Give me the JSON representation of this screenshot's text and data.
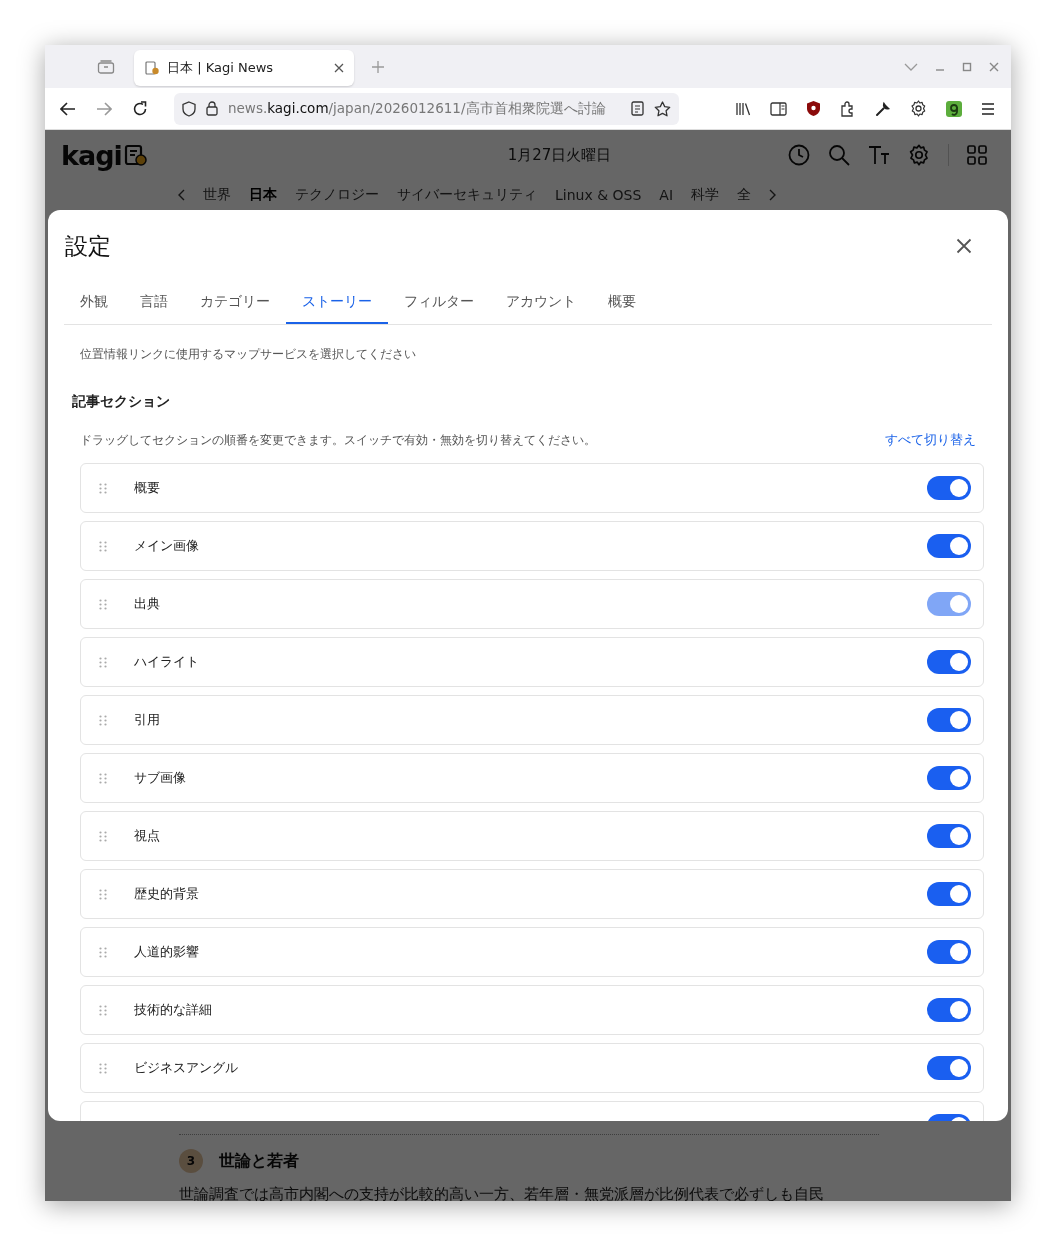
{
  "browser": {
    "tab_title": "日本 | Kagi News",
    "url_prefix": "news.",
    "url_domain": "kagi.com",
    "url_path": "/japan/2026012611/高市首相衆院選へ討論"
  },
  "page": {
    "logo": "kagi",
    "date": "1月27日火曜日",
    "nav": [
      {
        "label": "世界",
        "selected": false
      },
      {
        "label": "日本",
        "selected": true
      },
      {
        "label": "テクノロジー",
        "selected": false
      },
      {
        "label": "サイバーセキュリティ",
        "selected": false
      },
      {
        "label": "Linux & OSS",
        "selected": false
      },
      {
        "label": "AI",
        "selected": false
      },
      {
        "label": "科学",
        "selected": false
      },
      {
        "label": "全",
        "selected": false
      }
    ],
    "item_number": "3",
    "item_title": "世論と若者",
    "item_text": "世論調査では高市内閣への支持が比較的高い一方、若年層・無党派層が比例代表で必ずしも自民"
  },
  "dialog": {
    "title": "設定",
    "tabs": [
      {
        "label": "外観",
        "selected": false
      },
      {
        "label": "言語",
        "selected": false
      },
      {
        "label": "カテゴリー",
        "selected": false
      },
      {
        "label": "ストーリー",
        "selected": true
      },
      {
        "label": "フィルター",
        "selected": false
      },
      {
        "label": "アカウント",
        "selected": false
      },
      {
        "label": "概要",
        "selected": false
      }
    ],
    "note": "位置情報リンクに使用するマップサービスを選択してください",
    "section_title": "記事セクション",
    "section_hint": "ドラッグしてセクションの順番を変更できます。スイッチで有効・無効を切り替えてください。",
    "toggle_all": "すべて切り替え",
    "sections": [
      {
        "label": "概要",
        "on": true,
        "disabled": false
      },
      {
        "label": "メイン画像",
        "on": true,
        "disabled": false
      },
      {
        "label": "出典",
        "on": true,
        "disabled": true
      },
      {
        "label": "ハイライト",
        "on": true,
        "disabled": false
      },
      {
        "label": "引用",
        "on": true,
        "disabled": false
      },
      {
        "label": "サブ画像",
        "on": true,
        "disabled": false
      },
      {
        "label": "視点",
        "on": true,
        "disabled": false
      },
      {
        "label": "歴史的背景",
        "on": true,
        "disabled": false
      },
      {
        "label": "人道的影響",
        "on": true,
        "disabled": false
      },
      {
        "label": "技術的な詳細",
        "on": true,
        "disabled": false
      },
      {
        "label": "ビジネスアングル",
        "on": true,
        "disabled": false
      },
      {
        "on": true,
        "disabled": false
      }
    ]
  }
}
